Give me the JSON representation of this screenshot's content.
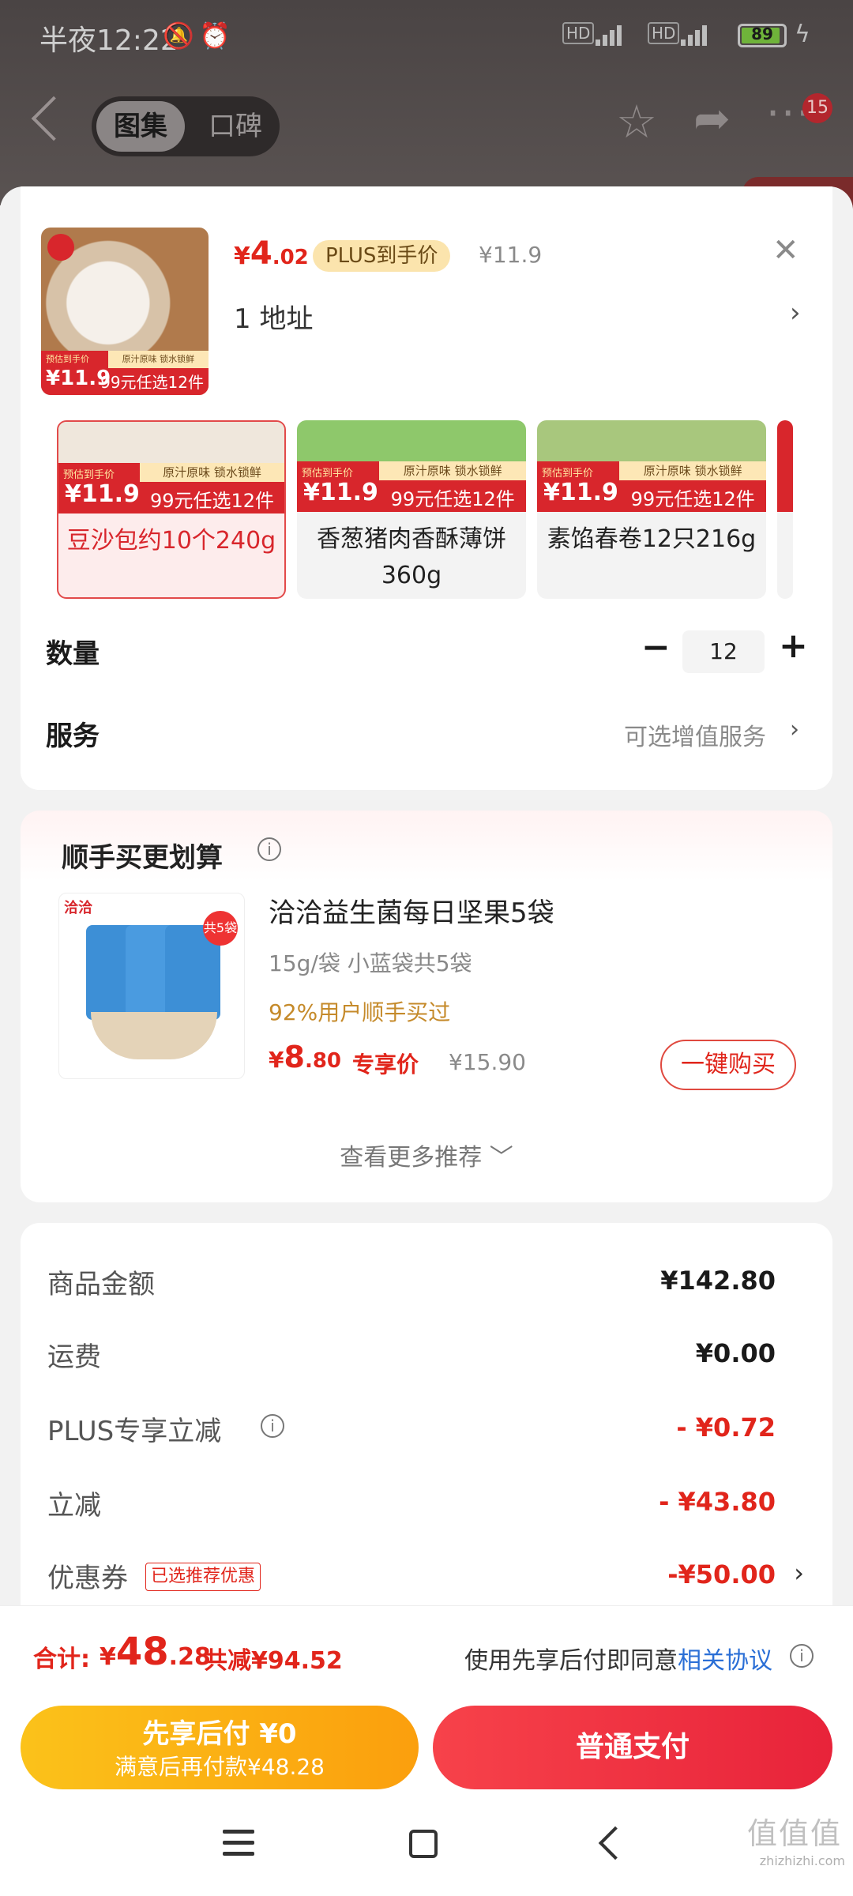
{
  "status_bar": {
    "time": "半夜12:22",
    "network_1": "HD",
    "network_2": "HD",
    "signal_1": "4G",
    "signal_2": "4G",
    "battery": "89"
  },
  "nav": {
    "tabs": [
      "图集",
      "口碑"
    ],
    "badge_count": "15"
  },
  "product": {
    "price_currency": "¥",
    "price_int": "4",
    "price_dec": ".02",
    "plus_tag": "PLUS到手价",
    "original_price": "¥11.9",
    "address": "1  地址",
    "thumb_promo_top": "预估到手价",
    "thumb_promo_price": "¥11.9",
    "thumb_promo_strip": "原汁原味 锁水锁鲜",
    "thumb_promo_deal": "99元任选12件"
  },
  "variants": [
    {
      "name": "豆沙包约10个240g",
      "promo_label": "预估到手价",
      "promo_price": "¥11.9",
      "promo_strip": "原汁原味 锁水锁鲜",
      "promo_deal": "99元任选12件",
      "selected": true,
      "color": "#efe7dc"
    },
    {
      "name": "香葱猪肉香酥薄饼360g",
      "promo_label": "预估到手价",
      "promo_price": "¥11.9",
      "promo_strip": "原汁原味 锁水锁鲜",
      "promo_deal": "99元任选12件",
      "selected": false,
      "color": "#8ec86b"
    },
    {
      "name": "素馅春卷12只216g",
      "promo_label": "预估到手价",
      "promo_price": "¥11.9",
      "promo_strip": "原汁原味 锁水锁鲜",
      "promo_deal": "99元任选12件",
      "selected": false,
      "color": "#a8c77d"
    }
  ],
  "quantity": {
    "label": "数量",
    "minus": "−",
    "value": "12",
    "plus": "+"
  },
  "service": {
    "label": "服务",
    "value": "可选增值服务"
  },
  "recommend": {
    "title": "顺手买更划算",
    "brand": "洽洽",
    "badge": "共5袋",
    "name": "洽洽益生菌每日坚果5袋",
    "spec": "15g/袋 小蓝袋共5袋",
    "social": "92%用户顺手买过",
    "price_currency": "¥",
    "price_int": "8",
    "price_dec": ".80",
    "price_label": "专享价",
    "old_price": "¥15.90",
    "buy_button": "一键购买",
    "more": "查看更多推荐"
  },
  "cost": {
    "rows": [
      {
        "label": "商品金额",
        "value": "¥142.80"
      },
      {
        "label": "运费",
        "value": "¥0.00"
      },
      {
        "label": "PLUS专享立减",
        "value": "- ¥0.72"
      },
      {
        "label": "立减",
        "value": "- ¥43.80"
      },
      {
        "label": "优惠券",
        "tag": "已选推荐优惠",
        "value": "-¥50.00"
      }
    ]
  },
  "bottom": {
    "total_label": "合计:",
    "total_currency": "¥",
    "total_int": "48",
    "total_dec": ".28",
    "total_saved": "共减¥94.52",
    "agree_text": "使用先享后付即同意",
    "agree_link": "相关协议",
    "pay_later_title": "先享后付 ¥0",
    "pay_later_sub": "满意后再付款¥48.28",
    "pay_normal": "普通支付"
  },
  "watermark": {
    "logo": "值值值",
    "url": "zhizhizhi.com"
  },
  "colors": {
    "accent_red": "#e1251b",
    "plus_gold": "#fbe4ad",
    "pay_later_orange": "#fbc21a",
    "link_blue": "#2b6fd6"
  }
}
